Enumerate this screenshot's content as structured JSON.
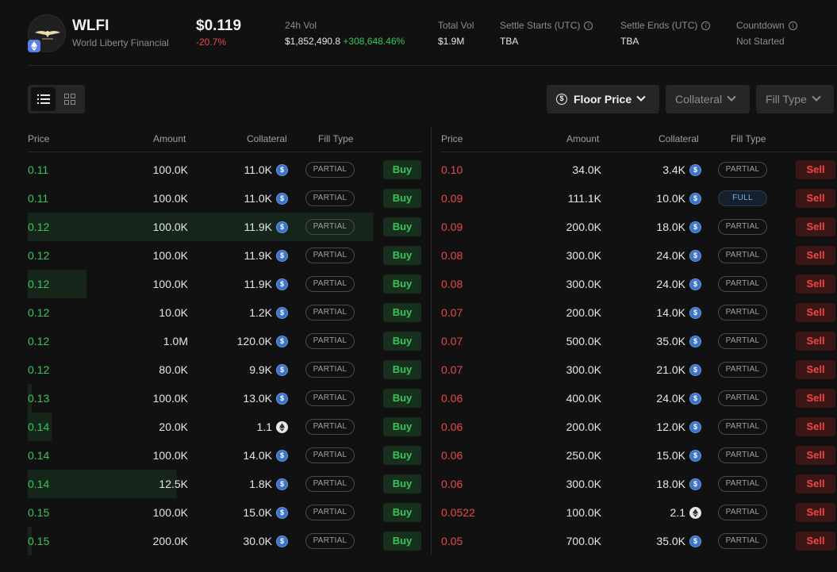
{
  "header": {
    "token_symbol": "WLFI",
    "token_name": "World Liberty Financial",
    "price": "$0.119",
    "change": "-20.7%",
    "stats": {
      "vol24_label": "24h Vol",
      "vol24_value": "$1,852,490.8",
      "vol24_change": "+308,648.46%",
      "total_vol_label": "Total Vol",
      "total_vol_value": "$1.9M",
      "settle_start_label": "Settle Starts (UTC)",
      "settle_start_value": "TBA",
      "settle_end_label": "Settle Ends (UTC)",
      "settle_end_value": "TBA",
      "countdown_label": "Countdown",
      "countdown_value": "Not Started"
    }
  },
  "toolbar": {
    "floor_price": "Floor Price",
    "collateral": "Collateral",
    "fill_type": "Fill Type"
  },
  "columns": {
    "price": "Price",
    "amount": "Amount",
    "collateral": "Collateral",
    "fill_type": "Fill Type"
  },
  "buy_orders": [
    {
      "price": "0.11",
      "amount": "100.0K",
      "collateral": "11.0K",
      "coin": "usdc",
      "fill": "PARTIAL",
      "action": "Buy",
      "depth": 0
    },
    {
      "price": "0.11",
      "amount": "100.0K",
      "collateral": "11.0K",
      "coin": "usdc",
      "fill": "PARTIAL",
      "action": "Buy",
      "depth": 0
    },
    {
      "price": "0.12",
      "amount": "100.0K",
      "collateral": "11.9K",
      "coin": "usdc",
      "fill": "PARTIAL",
      "action": "Buy",
      "depth": 0.88
    },
    {
      "price": "0.12",
      "amount": "100.0K",
      "collateral": "11.9K",
      "coin": "usdc",
      "fill": "PARTIAL",
      "action": "Buy",
      "depth": 0
    },
    {
      "price": "0.12",
      "amount": "100.0K",
      "collateral": "11.9K",
      "coin": "usdc",
      "fill": "PARTIAL",
      "action": "Buy",
      "depth": 0.15
    },
    {
      "price": "0.12",
      "amount": "10.0K",
      "collateral": "1.2K",
      "coin": "usdc",
      "fill": "PARTIAL",
      "action": "Buy",
      "depth": 0
    },
    {
      "price": "0.12",
      "amount": "1.0M",
      "collateral": "120.0K",
      "coin": "usdc",
      "fill": "PARTIAL",
      "action": "Buy",
      "depth": 0
    },
    {
      "price": "0.12",
      "amount": "80.0K",
      "collateral": "9.9K",
      "coin": "usdc",
      "fill": "PARTIAL",
      "action": "Buy",
      "depth": 0
    },
    {
      "price": "0.13",
      "amount": "100.0K",
      "collateral": "13.0K",
      "coin": "usdc",
      "fill": "PARTIAL",
      "action": "Buy",
      "depth": 0.01
    },
    {
      "price": "0.14",
      "amount": "20.0K",
      "collateral": "1.1",
      "coin": "eth",
      "fill": "PARTIAL",
      "action": "Buy",
      "depth": 0.06
    },
    {
      "price": "0.14",
      "amount": "100.0K",
      "collateral": "14.0K",
      "coin": "usdc",
      "fill": "PARTIAL",
      "action": "Buy",
      "depth": 0
    },
    {
      "price": "0.14",
      "amount": "12.5K",
      "collateral": "1.8K",
      "coin": "usdc",
      "fill": "PARTIAL",
      "action": "Buy",
      "depth": 0.38
    },
    {
      "price": "0.15",
      "amount": "100.0K",
      "collateral": "15.0K",
      "coin": "usdc",
      "fill": "PARTIAL",
      "action": "Buy",
      "depth": 0
    },
    {
      "price": "0.15",
      "amount": "200.0K",
      "collateral": "30.0K",
      "coin": "usdc",
      "fill": "PARTIAL",
      "action": "Buy",
      "depth": 0.01
    }
  ],
  "sell_orders": [
    {
      "price": "0.10",
      "amount": "34.0K",
      "collateral": "3.4K",
      "coin": "usdc",
      "fill": "PARTIAL",
      "action": "Sell"
    },
    {
      "price": "0.09",
      "amount": "111.1K",
      "collateral": "10.0K",
      "coin": "usdc",
      "fill": "FULL",
      "action": "Sell"
    },
    {
      "price": "0.09",
      "amount": "200.0K",
      "collateral": "18.0K",
      "coin": "usdc",
      "fill": "PARTIAL",
      "action": "Sell"
    },
    {
      "price": "0.08",
      "amount": "300.0K",
      "collateral": "24.0K",
      "coin": "usdc",
      "fill": "PARTIAL",
      "action": "Sell"
    },
    {
      "price": "0.08",
      "amount": "300.0K",
      "collateral": "24.0K",
      "coin": "usdc",
      "fill": "PARTIAL",
      "action": "Sell"
    },
    {
      "price": "0.07",
      "amount": "200.0K",
      "collateral": "14.0K",
      "coin": "usdc",
      "fill": "PARTIAL",
      "action": "Sell"
    },
    {
      "price": "0.07",
      "amount": "500.0K",
      "collateral": "35.0K",
      "coin": "usdc",
      "fill": "PARTIAL",
      "action": "Sell"
    },
    {
      "price": "0.07",
      "amount": "300.0K",
      "collateral": "21.0K",
      "coin": "usdc",
      "fill": "PARTIAL",
      "action": "Sell"
    },
    {
      "price": "0.06",
      "amount": "400.0K",
      "collateral": "24.0K",
      "coin": "usdc",
      "fill": "PARTIAL",
      "action": "Sell"
    },
    {
      "price": "0.06",
      "amount": "200.0K",
      "collateral": "12.0K",
      "coin": "usdc",
      "fill": "PARTIAL",
      "action": "Sell"
    },
    {
      "price": "0.06",
      "amount": "250.0K",
      "collateral": "15.0K",
      "coin": "usdc",
      "fill": "PARTIAL",
      "action": "Sell"
    },
    {
      "price": "0.06",
      "amount": "300.0K",
      "collateral": "18.0K",
      "coin": "usdc",
      "fill": "PARTIAL",
      "action": "Sell"
    },
    {
      "price": "0.0522",
      "amount": "100.0K",
      "collateral": "2.1",
      "coin": "eth",
      "fill": "PARTIAL",
      "action": "Sell"
    },
    {
      "price": "0.05",
      "amount": "700.0K",
      "collateral": "35.0K",
      "coin": "usdc",
      "fill": "PARTIAL",
      "action": "Sell"
    }
  ]
}
